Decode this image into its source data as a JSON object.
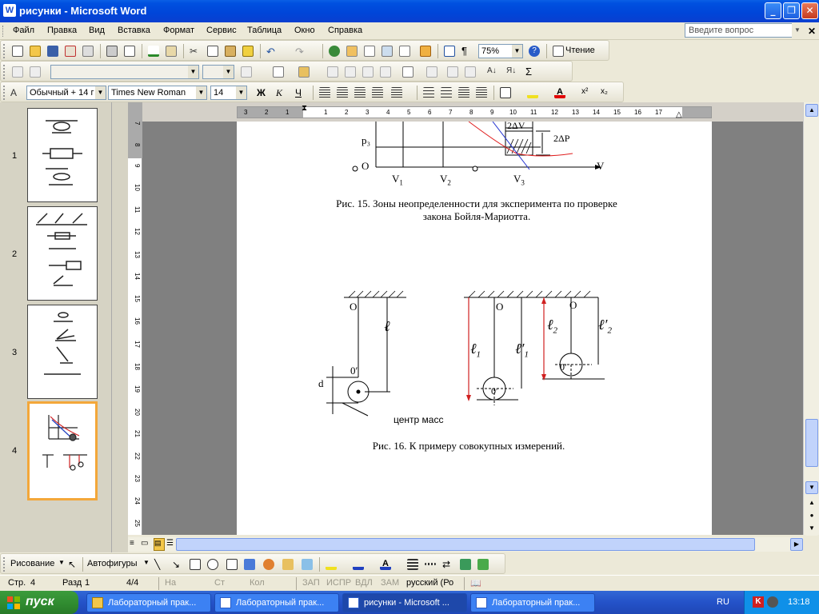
{
  "window": {
    "title": "рисунки - Microsoft Word",
    "app_icon": "W"
  },
  "menu": {
    "items": [
      "Файл",
      "Правка",
      "Вид",
      "Вставка",
      "Формат",
      "Сервис",
      "Таблица",
      "Окно",
      "Справка"
    ],
    "help_placeholder": "Введите вопрос"
  },
  "standard_toolbar": {
    "zoom": "75%",
    "reading_label": "Чтение"
  },
  "formatting_toolbar": {
    "style": "Обычный + 14 г",
    "font": "Times New Roman",
    "size": "14"
  },
  "thumbnails": [
    "1",
    "2",
    "3",
    "4"
  ],
  "ruler": {
    "h_left": [
      "3",
      "2",
      "1"
    ],
    "h_right": [
      "1",
      "2",
      "3",
      "4",
      "5",
      "6",
      "7",
      "8",
      "9",
      "10",
      "11",
      "12",
      "13",
      "14",
      "15",
      "16",
      "17"
    ],
    "v": [
      "7",
      "8",
      "9",
      "10",
      "11",
      "12",
      "13",
      "14",
      "15",
      "16",
      "17",
      "18",
      "19",
      "20",
      "21",
      "22",
      "23",
      "24",
      "25"
    ]
  },
  "document": {
    "fig15": {
      "p3": "p₃",
      "O": "O",
      "V": "V",
      "dV": "2ΔV",
      "dP": "2ΔP",
      "V1": "V",
      "V2": "V",
      "V3": "V",
      "sub1": "1",
      "sub2": "2",
      "sub3": "3",
      "caption_line1": "Рис. 15. Зоны неопределенности для эксперимента по проверке",
      "caption_line2": "закона Бойля-Мариотта."
    },
    "fig16": {
      "O": "O",
      "O_prime": "0′",
      "d": "d",
      "l": "ℓ",
      "l1": "ℓ",
      "l1p": "ℓ′",
      "l2": "ℓ",
      "l2p": "ℓ′",
      "s1": "1",
      "s2": "2",
      "center_mass": "центр масс",
      "caption": "Рис. 16. К примеру совокупных измерений."
    }
  },
  "drawing_toolbar": {
    "draw_label": "Рисование",
    "autoshapes_label": "Автофигуры"
  },
  "status": {
    "page": "Стр.",
    "page_num": "4",
    "section": "Разд",
    "section_num": "1",
    "pages": "4/4",
    "at": "На",
    "ln": "Ст",
    "col": "Кол",
    "rec": "ЗАП",
    "trk": "ИСПР",
    "ext": "ВДЛ",
    "ovr": "ЗАМ",
    "language": "русский (Ро"
  },
  "taskbar": {
    "start_label": "пуск",
    "tasks": [
      "Лабораторный прак...",
      "Лабораторный прак...",
      "рисунки - Microsoft ...",
      "Лабораторный прак..."
    ],
    "language": "RU",
    "time": "13:18"
  }
}
